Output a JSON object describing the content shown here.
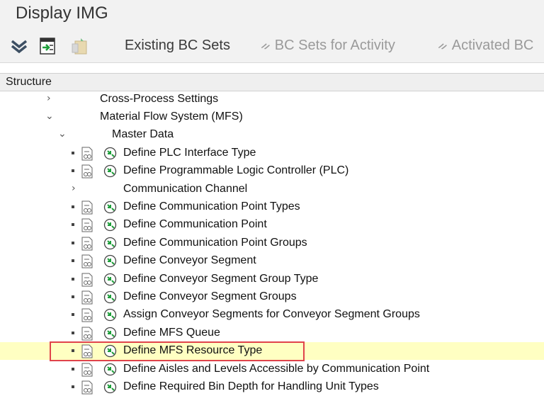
{
  "window": {
    "title": "Display IMG"
  },
  "toolbar": {
    "buttons": [
      {
        "label": "Existing BC Sets"
      },
      {
        "label": "BC Sets for Activity"
      },
      {
        "label": "Activated BC"
      }
    ]
  },
  "structure": {
    "header": "Structure",
    "rows": [
      {
        "label": "Cross-Process Settings",
        "chevron": ">"
      },
      {
        "label": "Material Flow System (MFS)",
        "chevron": "v"
      },
      {
        "label": "Master Data",
        "chevron": "v"
      },
      {
        "label": "Define PLC Interface Type"
      },
      {
        "label": "Define Programmable Logic Controller (PLC)"
      },
      {
        "label": "Communication Channel",
        "chevron": ">"
      },
      {
        "label": "Define Communication Point Types"
      },
      {
        "label": "Define Communication Point"
      },
      {
        "label": "Define Communication Point Groups"
      },
      {
        "label": "Define Conveyor Segment"
      },
      {
        "label": "Define Conveyor Segment Group Type"
      },
      {
        "label": "Define Conveyor Segment Groups"
      },
      {
        "label": "Assign Conveyor Segments for Conveyor Segment Groups"
      },
      {
        "label": "Define MFS Queue"
      },
      {
        "label": "Define MFS Resource Type",
        "selected": true
      },
      {
        "label": "Define Aisles and Levels Accessible by Communication Point"
      },
      {
        "label": "Define Required Bin Depth for Handling Unit Types"
      }
    ]
  },
  "colors": {
    "highlight_border": "#e0434b",
    "selected_row": "#ffffc2"
  }
}
